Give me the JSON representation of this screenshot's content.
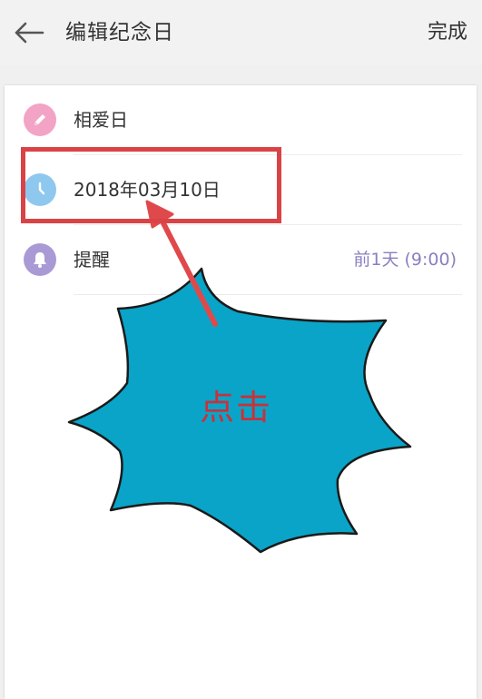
{
  "header": {
    "title": "编辑纪念日",
    "done_label": "完成",
    "back_icon": "arrow-left-icon"
  },
  "rows": [
    {
      "icon": "pencil-icon",
      "icon_color": "#f2a3c6",
      "label": "相爱日",
      "value": ""
    },
    {
      "icon": "clock-icon",
      "icon_color": "#8fc8ee",
      "label": "2018年03月10日",
      "value": ""
    },
    {
      "icon": "bell-icon",
      "icon_color": "#a99ad6",
      "label": "提醒",
      "value": "前1天 (9:00)"
    }
  ],
  "annotation": {
    "text": "点击",
    "highlight_color": "#d94346",
    "burst_color": "#0aa4c8",
    "text_color": "#c8323a"
  },
  "colors": {
    "background": "#f0f0f0",
    "card": "#ffffff",
    "accent_value": "#8a7fc0"
  }
}
